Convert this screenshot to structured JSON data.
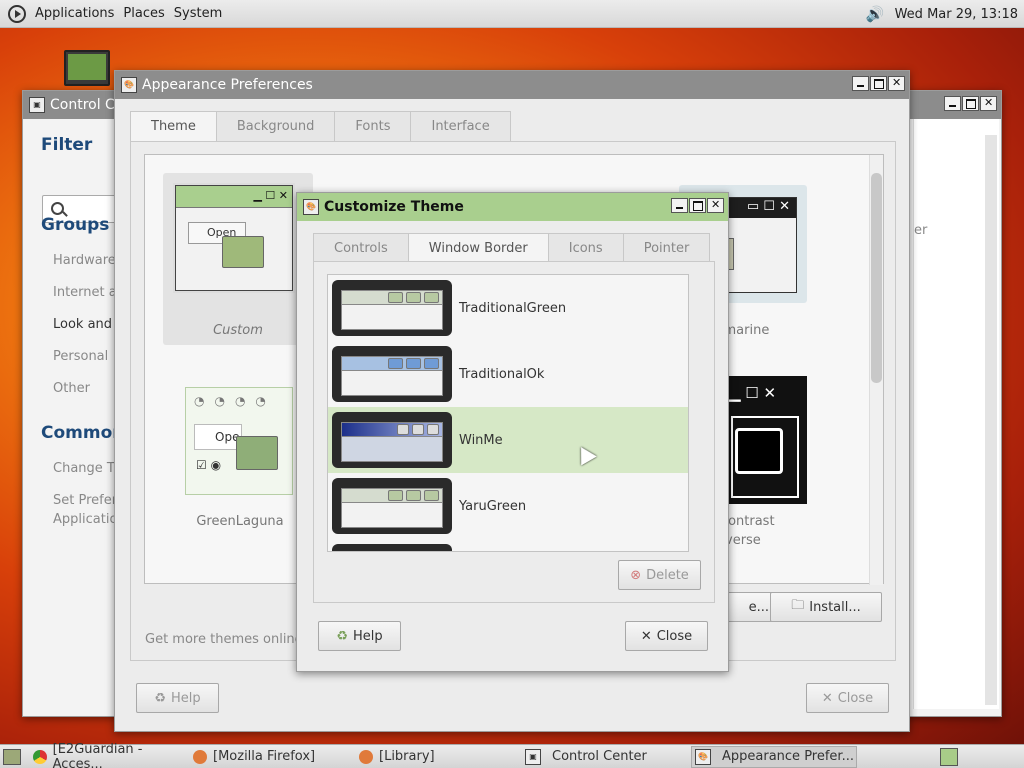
{
  "top_panel": {
    "menus": [
      "Applications",
      "Places",
      "System"
    ],
    "clock": "Wed Mar 29, 13:18"
  },
  "control_center": {
    "title": "Control Ce",
    "filter_heading": "Filter",
    "groups_heading": "Groups",
    "groups": [
      "Hardware",
      "Internet a",
      "Look and I",
      "Personal",
      "Other"
    ],
    "common_heading": "Common",
    "common_items": [
      "Change Th",
      "Set Prefer",
      "Applicatio"
    ],
    "right_fragment": "er"
  },
  "appearance": {
    "title": "Appearance Preferences",
    "tabs": [
      "Theme",
      "Background",
      "Fonts",
      "Interface"
    ],
    "themes": [
      "Custom",
      "ubmarine",
      "GreenLaguna",
      "Contrast",
      "verse"
    ],
    "footer_text": "Get more themes online",
    "button_partial": "e...",
    "install_label": "Install...",
    "help_label": "Help",
    "close_label": "Close",
    "thumb_fragments": {
      "open": "Open",
      "ope": "Ope",
      "pen": "pen"
    }
  },
  "customize": {
    "title": "Customize Theme",
    "tabs": [
      "Controls",
      "Window Border",
      "Icons",
      "Pointer"
    ],
    "active_tab": "Window Border",
    "items": [
      "TraditionalGreen",
      "TraditionalOk",
      "WinMe",
      "YaruGreen"
    ],
    "selected": "WinMe",
    "delete_label": "Delete",
    "help_label": "Help",
    "close_label": "Close"
  },
  "taskbar": {
    "items": [
      "[E2Guardian - Acces...",
      "[Mozilla Firefox]",
      "[Library]",
      "Control Center",
      "Appearance Prefer..."
    ]
  }
}
